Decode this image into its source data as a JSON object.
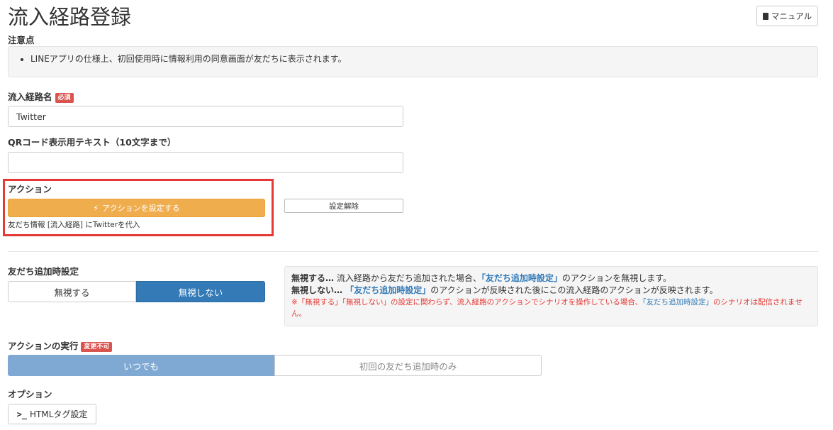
{
  "header": {
    "title": "流入経路登録",
    "manual_label": "マニュアル"
  },
  "notes": {
    "label": "注意点",
    "items": [
      "LINEアプリの仕様上、初回使用時に情報利用の同意画面が友だちに表示されます。"
    ]
  },
  "route_name": {
    "label": "流入経路名",
    "badge": "必須",
    "value": "Twitter"
  },
  "qr_text": {
    "label": "QRコード表示用テキスト（10文字まで）",
    "value": ""
  },
  "action": {
    "label": "アクション",
    "set_button": "アクションを設定する",
    "clear_button": "設定解除",
    "description": "友だち情報 [流入経路] にTwitterを代入"
  },
  "friend_add": {
    "label": "友だち追加時設定",
    "options": [
      "無視する",
      "無視しない"
    ],
    "selected": "無視しない",
    "info": {
      "line1_bold": "無視する…",
      "line1_a": " 流入経路から友だち追加された場合、",
      "line1_link": "「友だち追加時設定」",
      "line1_b": "のアクションを無視します。",
      "line2_bold": "無視しない…",
      "line2_link": " 「友だち追加時設定」",
      "line2_b": "のアクションが反映された後にこの流入経路のアクションが反映されます。",
      "warn_a": "※「無視する」「無視しない」の設定に関わらず、流入経路のアクションでシナリオを操作している場合、",
      "warn_link": "「友だち追加時設定」",
      "warn_b": "のシナリオは配信されません。"
    }
  },
  "action_exec": {
    "label": "アクションの実行",
    "badge": "変更不可",
    "options": [
      "いつでも",
      "初回の友だち追加時のみ"
    ],
    "selected": "いつでも"
  },
  "options": {
    "label": "オプション",
    "html_tag_button": "HTMLタグ設定"
  },
  "colors": {
    "primary": "#337ab7",
    "warning": "#f0ad4e",
    "danger": "#d9534f",
    "highlight": "#e53935"
  }
}
